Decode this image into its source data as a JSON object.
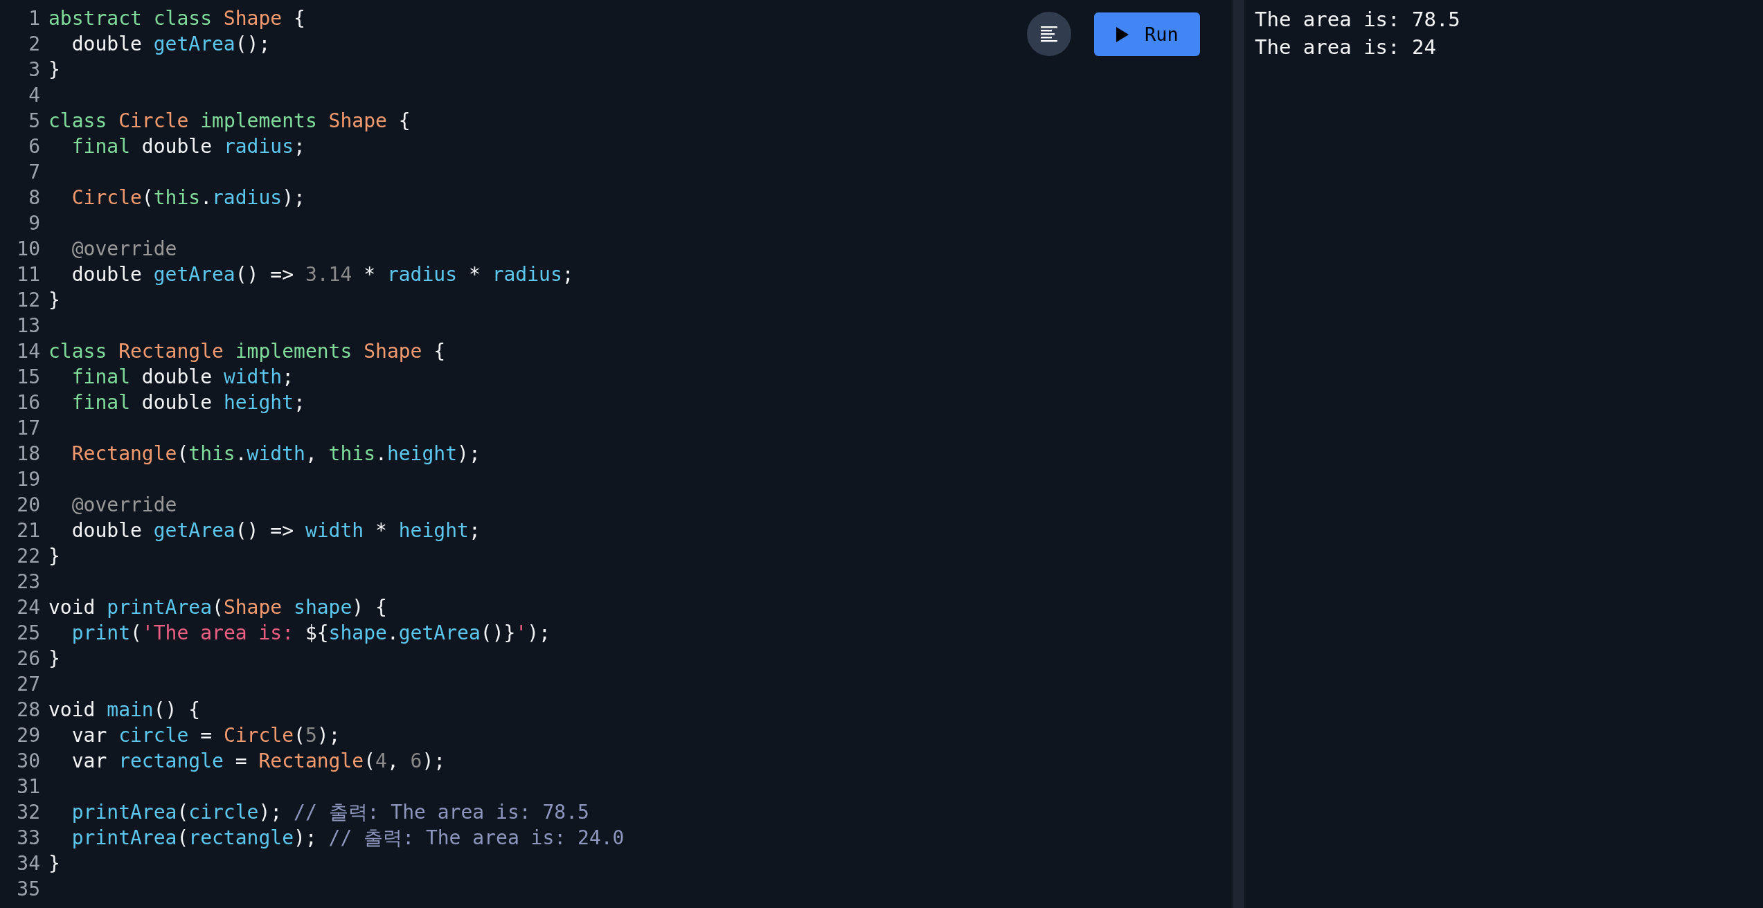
{
  "editor": {
    "lines": [
      {
        "number": "1",
        "tokens": [
          {
            "text": "abstract class",
            "kind": "keyword"
          },
          {
            "text": " Shape",
            "kind": "type"
          },
          {
            "text": " {",
            "kind": "plain"
          }
        ]
      },
      {
        "number": "2",
        "tokens": [
          {
            "text": "  double ",
            "kind": "plain"
          },
          {
            "text": "getArea",
            "kind": "ident"
          },
          {
            "text": "();",
            "kind": "plain"
          }
        ]
      },
      {
        "number": "3",
        "tokens": [
          {
            "text": "}",
            "kind": "plain"
          }
        ]
      },
      {
        "number": "4"
      },
      {
        "number": "5",
        "tokens": [
          {
            "text": "class",
            "kind": "keyword"
          },
          {
            "text": " Circle",
            "kind": "type"
          },
          {
            "text": " implements",
            "kind": "keyword"
          },
          {
            "text": " Shape",
            "kind": "type"
          },
          {
            "text": " {",
            "kind": "plain"
          }
        ]
      },
      {
        "number": "6",
        "tokens": [
          {
            "text": "  final",
            "kind": "keyword"
          },
          {
            "text": " double ",
            "kind": "plain"
          },
          {
            "text": "radius",
            "kind": "ident"
          },
          {
            "text": ";",
            "kind": "plain"
          }
        ]
      },
      {
        "number": "7"
      },
      {
        "number": "8",
        "tokens": [
          {
            "text": "  Circle",
            "kind": "type"
          },
          {
            "text": "(",
            "kind": "plain"
          },
          {
            "text": "this",
            "kind": "keyword"
          },
          {
            "text": ".",
            "kind": "plain"
          },
          {
            "text": "radius",
            "kind": "ident"
          },
          {
            "text": ");",
            "kind": "plain"
          }
        ]
      },
      {
        "number": "9"
      },
      {
        "number": "10",
        "tokens": [
          {
            "text": "  @override",
            "kind": "annotation"
          }
        ]
      },
      {
        "number": "11",
        "tokens": [
          {
            "text": "  double ",
            "kind": "plain"
          },
          {
            "text": "getArea",
            "kind": "ident"
          },
          {
            "text": "() => ",
            "kind": "plain"
          },
          {
            "text": "3.14",
            "kind": "number"
          },
          {
            "text": " * ",
            "kind": "plain"
          },
          {
            "text": "radius",
            "kind": "ident"
          },
          {
            "text": " * ",
            "kind": "plain"
          },
          {
            "text": "radius",
            "kind": "ident"
          },
          {
            "text": ";",
            "kind": "plain"
          }
        ]
      },
      {
        "number": "12",
        "tokens": [
          {
            "text": "}",
            "kind": "plain"
          }
        ]
      },
      {
        "number": "13"
      },
      {
        "number": "14",
        "tokens": [
          {
            "text": "class",
            "kind": "keyword"
          },
          {
            "text": " Rectangle",
            "kind": "type"
          },
          {
            "text": " implements",
            "kind": "keyword"
          },
          {
            "text": " Shape",
            "kind": "type"
          },
          {
            "text": " {",
            "kind": "plain"
          }
        ]
      },
      {
        "number": "15",
        "tokens": [
          {
            "text": "  final",
            "kind": "keyword"
          },
          {
            "text": " double ",
            "kind": "plain"
          },
          {
            "text": "width",
            "kind": "ident"
          },
          {
            "text": ";",
            "kind": "plain"
          }
        ]
      },
      {
        "number": "16",
        "tokens": [
          {
            "text": "  final",
            "kind": "keyword"
          },
          {
            "text": " double ",
            "kind": "plain"
          },
          {
            "text": "height",
            "kind": "ident"
          },
          {
            "text": ";",
            "kind": "plain"
          }
        ]
      },
      {
        "number": "17"
      },
      {
        "number": "18",
        "tokens": [
          {
            "text": "  Rectangle",
            "kind": "type"
          },
          {
            "text": "(",
            "kind": "plain"
          },
          {
            "text": "this",
            "kind": "keyword"
          },
          {
            "text": ".",
            "kind": "plain"
          },
          {
            "text": "width",
            "kind": "ident"
          },
          {
            "text": ", ",
            "kind": "plain"
          },
          {
            "text": "this",
            "kind": "keyword"
          },
          {
            "text": ".",
            "kind": "plain"
          },
          {
            "text": "height",
            "kind": "ident"
          },
          {
            "text": ");",
            "kind": "plain"
          }
        ]
      },
      {
        "number": "19"
      },
      {
        "number": "20",
        "tokens": [
          {
            "text": "  @override",
            "kind": "annotation"
          }
        ]
      },
      {
        "number": "21",
        "tokens": [
          {
            "text": "  double ",
            "kind": "plain"
          },
          {
            "text": "getArea",
            "kind": "ident"
          },
          {
            "text": "() => ",
            "kind": "plain"
          },
          {
            "text": "width",
            "kind": "ident"
          },
          {
            "text": " * ",
            "kind": "plain"
          },
          {
            "text": "height",
            "kind": "ident"
          },
          {
            "text": ";",
            "kind": "plain"
          }
        ]
      },
      {
        "number": "22",
        "tokens": [
          {
            "text": "}",
            "kind": "plain"
          }
        ]
      },
      {
        "number": "23"
      },
      {
        "number": "24",
        "tokens": [
          {
            "text": "void ",
            "kind": "plain"
          },
          {
            "text": "printArea",
            "kind": "ident"
          },
          {
            "text": "(",
            "kind": "plain"
          },
          {
            "text": "Shape",
            "kind": "type"
          },
          {
            "text": " shape",
            "kind": "ident"
          },
          {
            "text": ") {",
            "kind": "plain"
          }
        ]
      },
      {
        "number": "25",
        "tokens": [
          {
            "text": "  print",
            "kind": "ident"
          },
          {
            "text": "(",
            "kind": "plain"
          },
          {
            "text": "'The area is: ",
            "kind": "string"
          },
          {
            "text": "${",
            "kind": "plain"
          },
          {
            "text": "shape",
            "kind": "ident"
          },
          {
            "text": ".",
            "kind": "plain"
          },
          {
            "text": "getArea",
            "kind": "ident"
          },
          {
            "text": "()}",
            "kind": "plain"
          },
          {
            "text": "'",
            "kind": "string"
          },
          {
            "text": ");",
            "kind": "plain"
          }
        ]
      },
      {
        "number": "26",
        "tokens": [
          {
            "text": "}",
            "kind": "plain"
          }
        ]
      },
      {
        "number": "27"
      },
      {
        "number": "28",
        "tokens": [
          {
            "text": "void ",
            "kind": "plain"
          },
          {
            "text": "main",
            "kind": "ident"
          },
          {
            "text": "() {",
            "kind": "plain"
          }
        ]
      },
      {
        "number": "29",
        "tokens": [
          {
            "text": "  var ",
            "kind": "plain"
          },
          {
            "text": "circle",
            "kind": "ident"
          },
          {
            "text": " = ",
            "kind": "plain"
          },
          {
            "text": "Circle",
            "kind": "type"
          },
          {
            "text": "(",
            "kind": "plain"
          },
          {
            "text": "5",
            "kind": "number"
          },
          {
            "text": ");",
            "kind": "plain"
          }
        ]
      },
      {
        "number": "30",
        "tokens": [
          {
            "text": "  var ",
            "kind": "plain"
          },
          {
            "text": "rectangle",
            "kind": "ident"
          },
          {
            "text": " = ",
            "kind": "plain"
          },
          {
            "text": "Rectangle",
            "kind": "type"
          },
          {
            "text": "(",
            "kind": "plain"
          },
          {
            "text": "4",
            "kind": "number"
          },
          {
            "text": ", ",
            "kind": "plain"
          },
          {
            "text": "6",
            "kind": "number"
          },
          {
            "text": ");",
            "kind": "plain"
          }
        ]
      },
      {
        "number": "31"
      },
      {
        "number": "32",
        "tokens": [
          {
            "text": "  printArea",
            "kind": "ident"
          },
          {
            "text": "(",
            "kind": "plain"
          },
          {
            "text": "circle",
            "kind": "ident"
          },
          {
            "text": "); ",
            "kind": "plain"
          },
          {
            "text": "// 출력: The area is: 78.5",
            "kind": "comment"
          }
        ]
      },
      {
        "number": "33",
        "tokens": [
          {
            "text": "  printArea",
            "kind": "ident"
          },
          {
            "text": "(",
            "kind": "plain"
          },
          {
            "text": "rectangle",
            "kind": "ident"
          },
          {
            "text": "); ",
            "kind": "plain"
          },
          {
            "text": "// 출력: The area is: 24.0",
            "kind": "comment"
          }
        ]
      },
      {
        "number": "34",
        "tokens": [
          {
            "text": "}",
            "kind": "plain"
          }
        ]
      },
      {
        "number": "35"
      }
    ]
  },
  "toolbar": {
    "run_button": {
      "label": "Run"
    }
  },
  "output": {
    "lines": [
      "The area is: 78.5",
      "The area is: 24"
    ]
  }
}
